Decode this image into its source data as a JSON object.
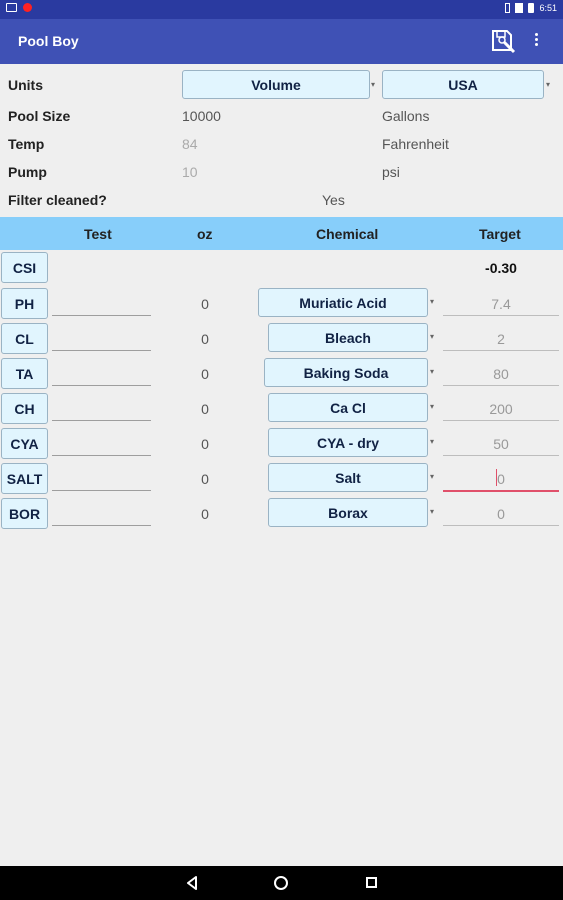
{
  "status_bar": {
    "time": "6:51"
  },
  "app_bar": {
    "title": "Pool Boy"
  },
  "settings": {
    "units_label": "Units",
    "units_measure": "Volume",
    "units_region": "USA",
    "pool_size_label": "Pool Size",
    "pool_size_value": "10000",
    "pool_size_unit": "Gallons",
    "temp_label": "Temp",
    "temp_value": "84",
    "temp_unit": "Fahrenheit",
    "pump_label": "Pump",
    "pump_value": "10",
    "pump_unit": "psi",
    "filter_label": "Filter cleaned?",
    "filter_value": "Yes"
  },
  "table": {
    "headers": {
      "test": "Test",
      "oz": "oz",
      "chemical": "Chemical",
      "target": "Target"
    },
    "csi": {
      "label": "CSI",
      "value": "-0.30"
    },
    "rows": [
      {
        "test": "PH",
        "oz": "0",
        "chemical": "Muriatic Acid",
        "target": "7.4"
      },
      {
        "test": "CL",
        "oz": "0",
        "chemical": "Bleach",
        "target": "2"
      },
      {
        "test": "TA",
        "oz": "0",
        "chemical": "Baking Soda",
        "target": "80"
      },
      {
        "test": "CH",
        "oz": "0",
        "chemical": "Ca Cl",
        "target": "200"
      },
      {
        "test": "CYA",
        "oz": "0",
        "chemical": "CYA - dry",
        "target": "50"
      },
      {
        "test": "SALT",
        "oz": "0",
        "chemical": "Salt",
        "target": "0"
      },
      {
        "test": "BOR",
        "oz": "0",
        "chemical": "Borax",
        "target": "0"
      }
    ]
  }
}
